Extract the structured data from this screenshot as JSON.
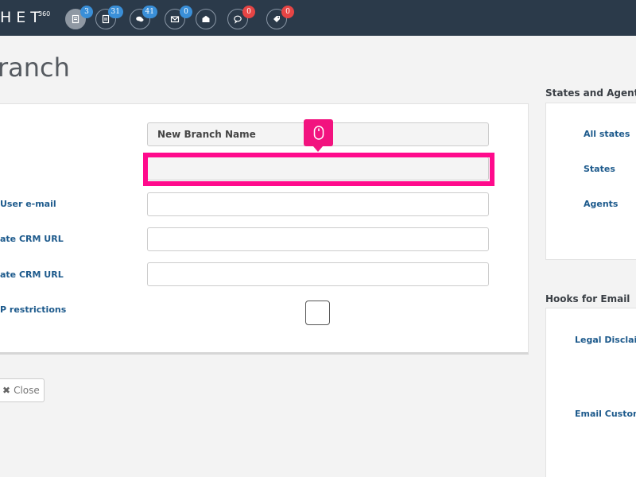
{
  "topbar": {
    "logo_text": "HET",
    "logo_sup": "360",
    "icons": [
      {
        "name": "documents-icon",
        "badge": "3",
        "badge_color": "#3a8fd8"
      },
      {
        "name": "document-list-icon",
        "badge": "31",
        "badge_color": "#3a8fd8"
      },
      {
        "name": "chat-bubbles-icon",
        "badge": "41",
        "badge_color": "#3a8fd8"
      },
      {
        "name": "envelope-icon",
        "badge": "0",
        "badge_color": "#3a8fd8"
      },
      {
        "name": "open-envelope-icon",
        "badge": "",
        "badge_color": ""
      },
      {
        "name": "comment-icon",
        "badge": "0",
        "badge_color": "#e64545"
      },
      {
        "name": "tag-icon",
        "badge": "0",
        "badge_color": "#e64545"
      }
    ]
  },
  "page": {
    "title": "ranch"
  },
  "form": {
    "branch_name_value": "New Branch Name",
    "second_field_value": "",
    "labels": {
      "user_email": "User e-mail",
      "crm_url_1": "ate CRM URL",
      "crm_url_2": "ate CRM URL",
      "ip_restrictions": "P restrictions"
    },
    "ip_restrictions_checked": false
  },
  "close_button": {
    "label": "Close"
  },
  "sidebar": {
    "states_agents": {
      "heading": "States and Agents",
      "links": [
        "All states",
        "States",
        "Agents"
      ]
    },
    "hooks": {
      "heading": "Hooks for Email",
      "links": [
        "Legal Disclaim",
        "Email Custom"
      ]
    }
  },
  "colors": {
    "topbar_bg": "#2b3a4a",
    "highlight": "#ff0a8c",
    "tooltip": "#f2137f",
    "link": "#1d5a8c"
  }
}
